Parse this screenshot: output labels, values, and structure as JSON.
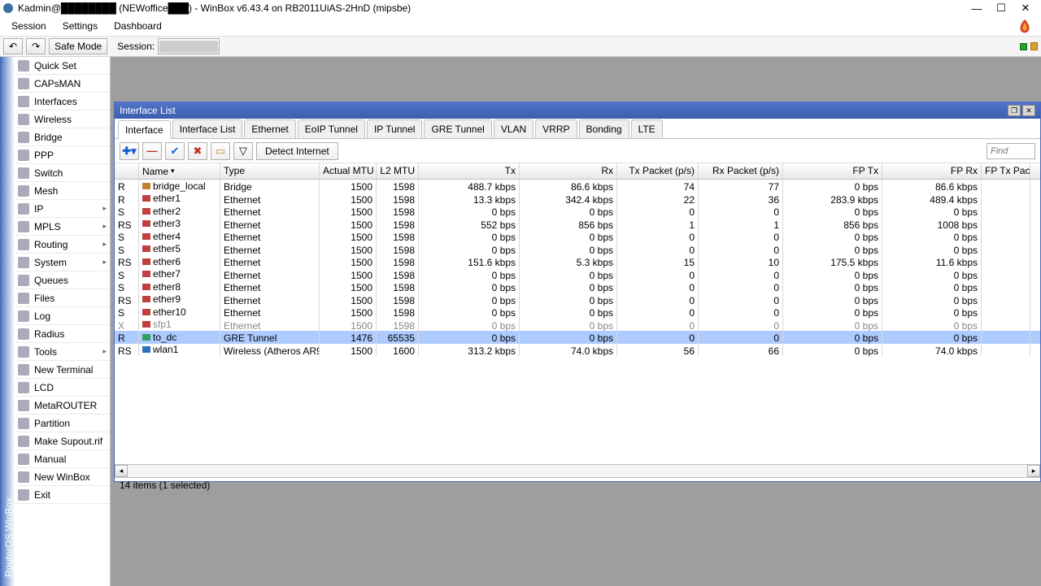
{
  "titlebar": {
    "text": "Kadmin@████████ (NEWoffice███) - WinBox v6.43.4 on RB2011UiAS-2HnD (mipsbe)"
  },
  "menubar": {
    "items": [
      "Session",
      "Settings",
      "Dashboard"
    ]
  },
  "toolbar": {
    "undo": "↶",
    "redo": "↷",
    "safe_mode": "Safe Mode",
    "session_label": "Session:",
    "session_value": "████████"
  },
  "sidebar_tab": "RouterOS WinBox",
  "nav": [
    {
      "label": "Quick Set",
      "arrow": false
    },
    {
      "label": "CAPsMAN",
      "arrow": false
    },
    {
      "label": "Interfaces",
      "arrow": false
    },
    {
      "label": "Wireless",
      "arrow": false
    },
    {
      "label": "Bridge",
      "arrow": false
    },
    {
      "label": "PPP",
      "arrow": false
    },
    {
      "label": "Switch",
      "arrow": false
    },
    {
      "label": "Mesh",
      "arrow": false
    },
    {
      "label": "IP",
      "arrow": true
    },
    {
      "label": "MPLS",
      "arrow": true
    },
    {
      "label": "Routing",
      "arrow": true
    },
    {
      "label": "System",
      "arrow": true
    },
    {
      "label": "Queues",
      "arrow": false
    },
    {
      "label": "Files",
      "arrow": false
    },
    {
      "label": "Log",
      "arrow": false
    },
    {
      "label": "Radius",
      "arrow": false
    },
    {
      "label": "Tools",
      "arrow": true
    },
    {
      "label": "New Terminal",
      "arrow": false
    },
    {
      "label": "LCD",
      "arrow": false
    },
    {
      "label": "MetaROUTER",
      "arrow": false
    },
    {
      "label": "Partition",
      "arrow": false
    },
    {
      "label": "Make Supout.rif",
      "arrow": false
    },
    {
      "label": "Manual",
      "arrow": false
    },
    {
      "label": "New WinBox",
      "arrow": false
    },
    {
      "label": "Exit",
      "arrow": false
    }
  ],
  "iwin": {
    "title": "Interface List",
    "tabs": [
      "Interface",
      "Interface List",
      "Ethernet",
      "EoIP Tunnel",
      "IP Tunnel",
      "GRE Tunnel",
      "VLAN",
      "VRRP",
      "Bonding",
      "LTE"
    ],
    "active_tab": 0,
    "add": "✚▾",
    "remove": "—",
    "enable": "✔",
    "disable": "✖",
    "comment": "▭",
    "filter": "▽",
    "detect": "Detect Internet",
    "find_placeholder": "Find",
    "columns": [
      "",
      "Name",
      "Type",
      "Actual MTU",
      "L2 MTU",
      "Tx",
      "Rx",
      "Tx Packet (p/s)",
      "Rx Packet (p/s)",
      "FP Tx",
      "FP Rx",
      "FP Tx Pac"
    ],
    "rows": [
      {
        "flag": "R",
        "icon": "br",
        "name": "bridge_local",
        "type": "Bridge",
        "mtu": "1500",
        "l2mtu": "1598",
        "tx": "488.7 kbps",
        "rx": "86.6 kbps",
        "txp": "74",
        "rxp": "77",
        "fptx": "0 bps",
        "fprx": "86.6 kbps",
        "sel": false,
        "dis": false
      },
      {
        "flag": "R",
        "icon": "eth",
        "name": "ether1",
        "type": "Ethernet",
        "mtu": "1500",
        "l2mtu": "1598",
        "tx": "13.3 kbps",
        "rx": "342.4 kbps",
        "txp": "22",
        "rxp": "36",
        "fptx": "283.9 kbps",
        "fprx": "489.4 kbps",
        "sel": false,
        "dis": false
      },
      {
        "flag": "S",
        "icon": "eth",
        "name": "ether2",
        "type": "Ethernet",
        "mtu": "1500",
        "l2mtu": "1598",
        "tx": "0 bps",
        "rx": "0 bps",
        "txp": "0",
        "rxp": "0",
        "fptx": "0 bps",
        "fprx": "0 bps",
        "sel": false,
        "dis": false
      },
      {
        "flag": "RS",
        "icon": "eth",
        "name": "ether3",
        "type": "Ethernet",
        "mtu": "1500",
        "l2mtu": "1598",
        "tx": "552 bps",
        "rx": "856 bps",
        "txp": "1",
        "rxp": "1",
        "fptx": "856 bps",
        "fprx": "1008 bps",
        "sel": false,
        "dis": false
      },
      {
        "flag": "S",
        "icon": "eth",
        "name": "ether4",
        "type": "Ethernet",
        "mtu": "1500",
        "l2mtu": "1598",
        "tx": "0 bps",
        "rx": "0 bps",
        "txp": "0",
        "rxp": "0",
        "fptx": "0 bps",
        "fprx": "0 bps",
        "sel": false,
        "dis": false
      },
      {
        "flag": "S",
        "icon": "eth",
        "name": "ether5",
        "type": "Ethernet",
        "mtu": "1500",
        "l2mtu": "1598",
        "tx": "0 bps",
        "rx": "0 bps",
        "txp": "0",
        "rxp": "0",
        "fptx": "0 bps",
        "fprx": "0 bps",
        "sel": false,
        "dis": false
      },
      {
        "flag": "RS",
        "icon": "eth",
        "name": "ether6",
        "type": "Ethernet",
        "mtu": "1500",
        "l2mtu": "1598",
        "tx": "151.6 kbps",
        "rx": "5.3 kbps",
        "txp": "15",
        "rxp": "10",
        "fptx": "175.5 kbps",
        "fprx": "11.6 kbps",
        "sel": false,
        "dis": false
      },
      {
        "flag": "S",
        "icon": "eth",
        "name": "ether7",
        "type": "Ethernet",
        "mtu": "1500",
        "l2mtu": "1598",
        "tx": "0 bps",
        "rx": "0 bps",
        "txp": "0",
        "rxp": "0",
        "fptx": "0 bps",
        "fprx": "0 bps",
        "sel": false,
        "dis": false
      },
      {
        "flag": "S",
        "icon": "eth",
        "name": "ether8",
        "type": "Ethernet",
        "mtu": "1500",
        "l2mtu": "1598",
        "tx": "0 bps",
        "rx": "0 bps",
        "txp": "0",
        "rxp": "0",
        "fptx": "0 bps",
        "fprx": "0 bps",
        "sel": false,
        "dis": false
      },
      {
        "flag": "RS",
        "icon": "eth",
        "name": "ether9",
        "type": "Ethernet",
        "mtu": "1500",
        "l2mtu": "1598",
        "tx": "0 bps",
        "rx": "0 bps",
        "txp": "0",
        "rxp": "0",
        "fptx": "0 bps",
        "fprx": "0 bps",
        "sel": false,
        "dis": false
      },
      {
        "flag": "S",
        "icon": "eth",
        "name": "ether10",
        "type": "Ethernet",
        "mtu": "1500",
        "l2mtu": "1598",
        "tx": "0 bps",
        "rx": "0 bps",
        "txp": "0",
        "rxp": "0",
        "fptx": "0 bps",
        "fprx": "0 bps",
        "sel": false,
        "dis": false
      },
      {
        "flag": "X",
        "icon": "eth",
        "name": "sfp1",
        "type": "Ethernet",
        "mtu": "1500",
        "l2mtu": "1598",
        "tx": "0 bps",
        "rx": "0 bps",
        "txp": "0",
        "rxp": "0",
        "fptx": "0 bps",
        "fprx": "0 bps",
        "sel": false,
        "dis": true
      },
      {
        "flag": "R",
        "icon": "gre",
        "name": "to_dc",
        "type": "GRE Tunnel",
        "mtu": "1476",
        "l2mtu": "65535",
        "tx": "0 bps",
        "rx": "0 bps",
        "txp": "0",
        "rxp": "0",
        "fptx": "0 bps",
        "fprx": "0 bps",
        "sel": true,
        "dis": false
      },
      {
        "flag": "RS",
        "icon": "wl",
        "name": "wlan1",
        "type": "Wireless (Atheros AR9...",
        "mtu": "1500",
        "l2mtu": "1600",
        "tx": "313.2 kbps",
        "rx": "74.0 kbps",
        "txp": "56",
        "rxp": "66",
        "fptx": "0 bps",
        "fprx": "74.0 kbps",
        "sel": false,
        "dis": false
      }
    ],
    "status": "14 items (1 selected)"
  }
}
